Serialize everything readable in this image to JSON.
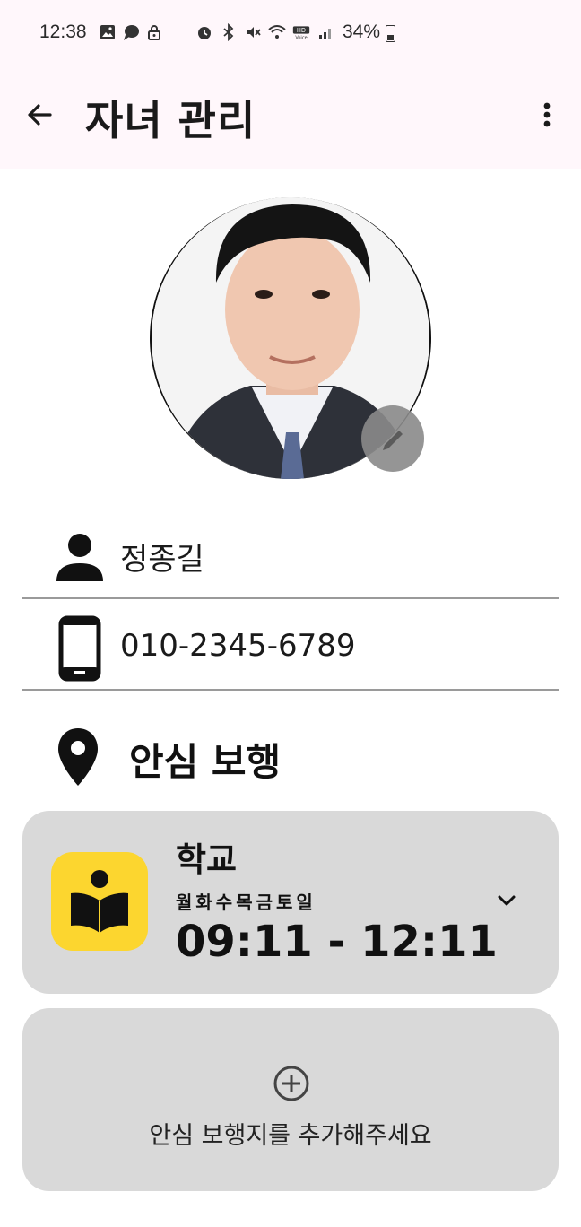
{
  "status_bar": {
    "time": "12:38",
    "battery": "34%",
    "icons": [
      "gallery-icon",
      "chat-icon",
      "lock-icon",
      "alarm-icon",
      "bluetooth-icon",
      "mute-icon",
      "wifi-icon",
      "hd-voice-icon",
      "signal-icon",
      "battery-icon"
    ]
  },
  "app_bar": {
    "title": "자녀 관리",
    "back_icon": "arrow-back-icon",
    "more_icon": "more-vert-icon"
  },
  "profile": {
    "name": "정종길",
    "phone": "010-2345-6789",
    "edit_icon": "edit-icon"
  },
  "safe_walk": {
    "title": "안심 보행",
    "items": [
      {
        "place": "학교",
        "days": "월화수목금토일",
        "time": "09:11 - 12:11"
      }
    ],
    "add_label": "안심 보행지를 추가해주세요"
  },
  "colors": {
    "app_bar_bg": "#fff7fb",
    "card_bg": "#d9d9d9",
    "place_icon_bg": "#fcd62f"
  }
}
